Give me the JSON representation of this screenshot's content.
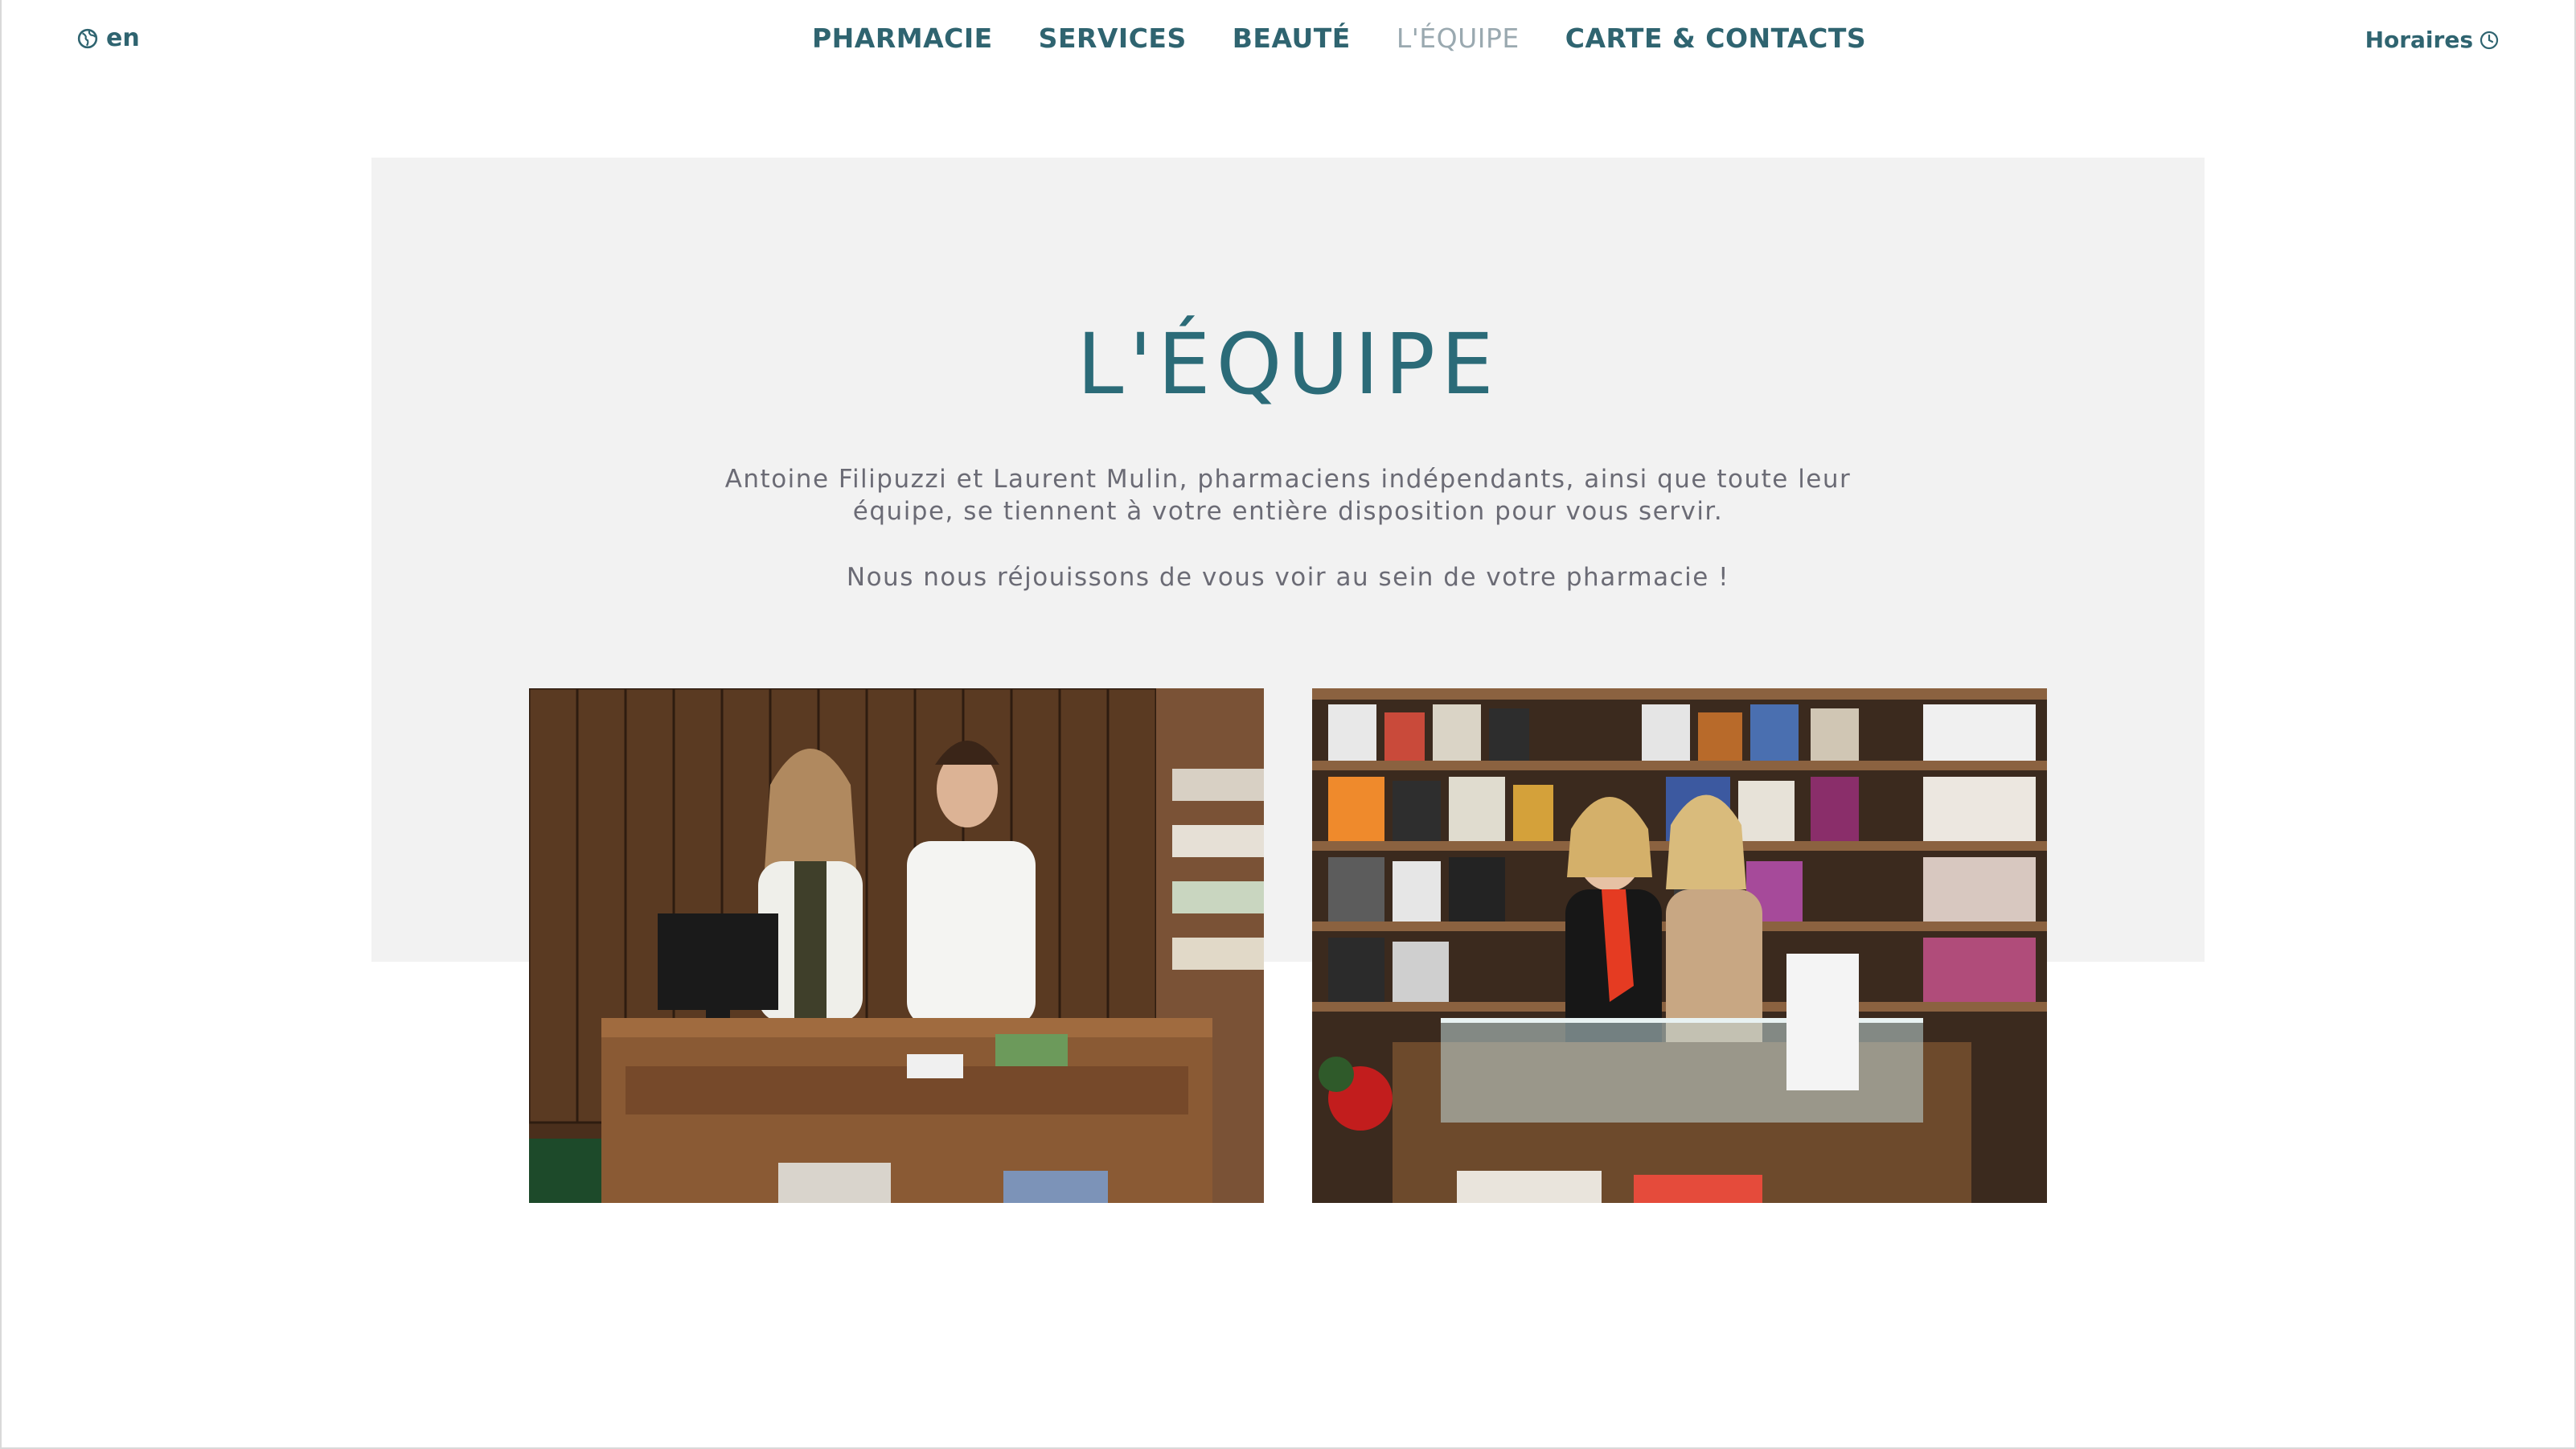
{
  "header": {
    "language": "en",
    "nav": [
      {
        "label": "PHARMACIE",
        "active": false
      },
      {
        "label": "SERVICES",
        "active": false
      },
      {
        "label": "BEAUTÉ",
        "active": false
      },
      {
        "label": "L'ÉQUIPE",
        "active": true
      },
      {
        "label": "CARTE & CONTACTS",
        "active": false
      }
    ],
    "hours_label": "Horaires"
  },
  "main": {
    "title": "L'ÉQUIPE",
    "intro": "Antoine Filipuzzi et Laurent Mulin, pharmaciens indépendants, ainsi que toute leur équipe, se tiennent à votre entière disposition pour vous servir.",
    "closing": "Nous nous réjouissons de vous voir au sein de votre pharmacie !"
  },
  "colors": {
    "brand": "#2f6470",
    "title": "#2b6b78",
    "nav_active": "#9aa9b0",
    "panel_bg": "#f2f2f2",
    "body_text": "#6b6b75"
  }
}
